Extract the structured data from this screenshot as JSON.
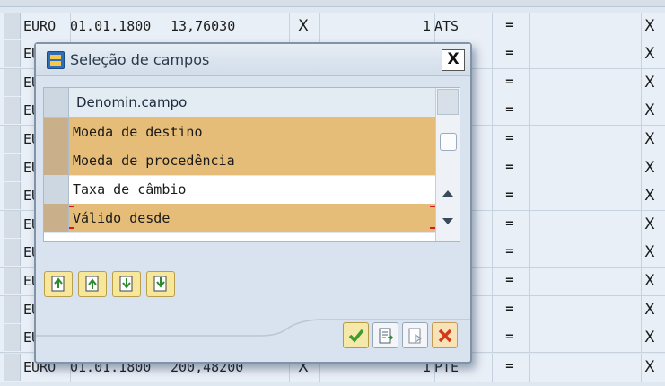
{
  "background_table": {
    "rows": [
      {
        "cells": [
          "EURO",
          "01.01.1800",
          "13,76030",
          "X",
          "1",
          "ATS",
          "=",
          "",
          "X"
        ]
      },
      {
        "cells": [
          "EURO",
          "",
          "",
          "",
          "",
          "",
          "=",
          "",
          "X"
        ]
      },
      {
        "cells": [
          "EURO",
          "",
          "",
          "",
          "",
          "",
          "=",
          "",
          "X"
        ]
      },
      {
        "cells": [
          "EURO",
          "",
          "",
          "",
          "",
          "",
          "=",
          "",
          "X"
        ]
      },
      {
        "cells": [
          "EURO",
          "",
          "",
          "",
          "",
          "",
          "=",
          "",
          "X"
        ]
      },
      {
        "cells": [
          "EURO",
          "",
          "",
          "",
          "",
          "",
          "=",
          "",
          "X"
        ]
      },
      {
        "cells": [
          "EURO",
          "",
          "",
          "",
          "",
          "",
          "=",
          "",
          "X"
        ]
      },
      {
        "cells": [
          "EURO",
          "",
          "",
          "",
          "",
          "",
          "=",
          "",
          "X"
        ]
      },
      {
        "cells": [
          "EURO",
          "",
          "",
          "",
          "",
          "",
          "=",
          "",
          "X"
        ]
      },
      {
        "cells": [
          "EURO",
          "",
          "",
          "",
          "",
          "",
          "=",
          "",
          "X"
        ]
      },
      {
        "cells": [
          "EURO",
          "",
          "",
          "",
          "",
          "",
          "=",
          "",
          "X"
        ]
      },
      {
        "cells": [
          "EURO",
          "",
          "",
          "",
          "",
          "",
          "=",
          "",
          "X"
        ]
      },
      {
        "cells": [
          "EURO",
          "01.01.1800",
          "200,48200",
          "X",
          "1",
          "PTE",
          "=",
          "",
          "X"
        ]
      }
    ],
    "visible_first_chars": [
      "EURO",
      "E",
      "E",
      "E",
      "E",
      "E",
      "E",
      "E",
      "E",
      "E",
      "E",
      "E",
      "EURO"
    ]
  },
  "dialog": {
    "title": "Seleção de campos",
    "close_label": "X",
    "list": {
      "header": "Denomin.campo",
      "items": [
        {
          "label": "Moeda de destino",
          "selected": true
        },
        {
          "label": "Moeda de procedência",
          "selected": true
        },
        {
          "label": "Taxa de câmbio",
          "selected": false
        },
        {
          "label": "Válido desde",
          "selected": true
        }
      ]
    },
    "toolbar_icons": [
      "select-all-icon",
      "select-block-icon",
      "deselect-block-icon",
      "deselect-all-icon"
    ],
    "actions": [
      "confirm-icon",
      "copy-icon",
      "paste-icon",
      "cancel-icon"
    ]
  },
  "colors": {
    "selected_row": "#e5bd78",
    "focus_frame": "#d11a2a",
    "confirm_check": "#3e9b2f",
    "cancel_x": "#d33a1a"
  }
}
